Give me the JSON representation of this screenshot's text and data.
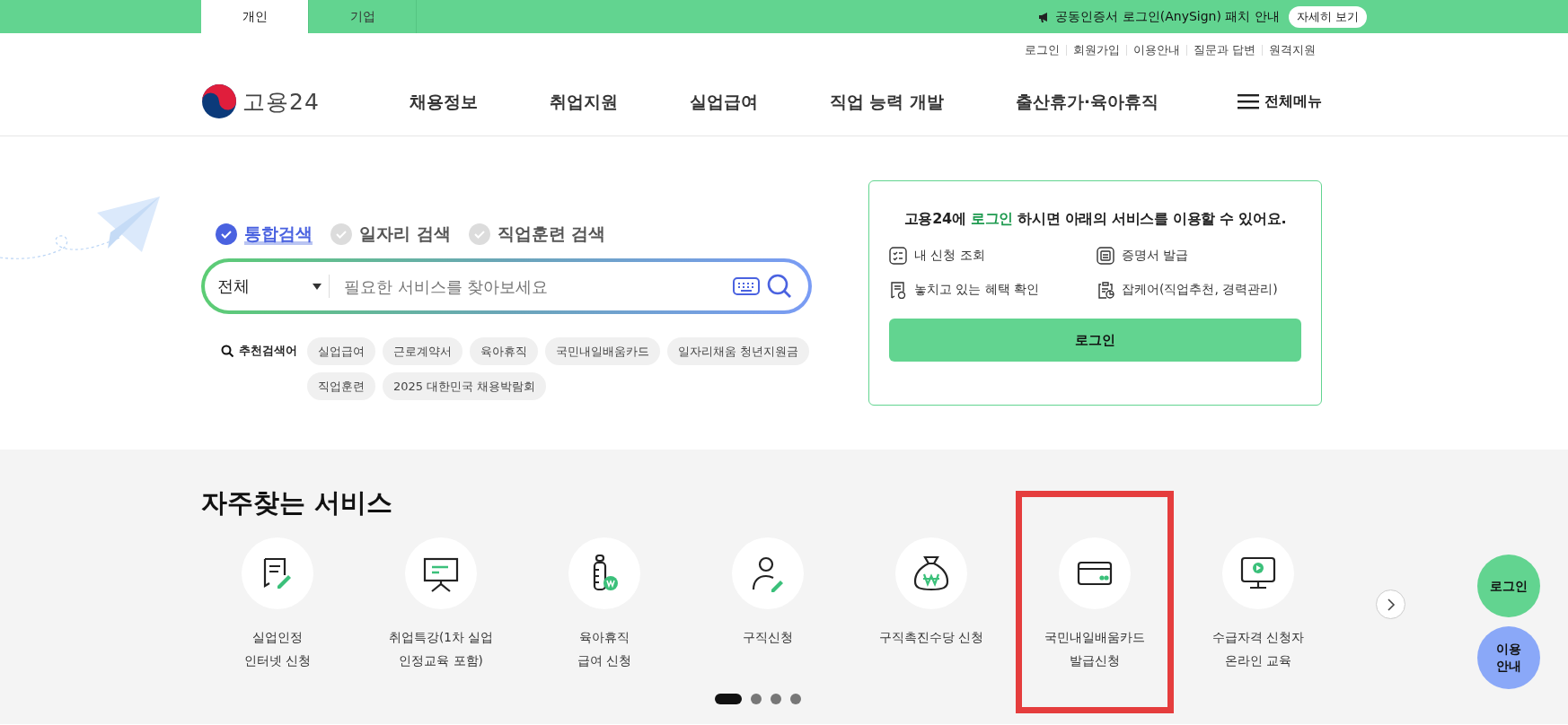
{
  "top_bar": {
    "tabs": [
      {
        "label": "개인",
        "selected": true
      },
      {
        "label": "기업",
        "selected": false
      }
    ],
    "notice": "공동인증서 로그인(AnySign) 패치 안내",
    "notice_button": "자세히 보기"
  },
  "utility_links": [
    "로그인",
    "회원가입",
    "이용안내",
    "질문과 답변",
    "원격지원"
  ],
  "header": {
    "logo_text": "고용24",
    "nav": [
      "채용정보",
      "취업지원",
      "실업급여",
      "직업 능력 개발",
      "출산휴가·육아휴직"
    ],
    "all_menu": "전체메뉴"
  },
  "search": {
    "tabs": [
      {
        "label": "통합검색",
        "selected": true
      },
      {
        "label": "일자리 검색",
        "selected": false
      },
      {
        "label": "직업훈련 검색",
        "selected": false
      }
    ],
    "category": "전체",
    "placeholder": "필요한 서비스를 찾아보세요",
    "recommended_label": "추천검색어",
    "recommended": [
      "실업급여",
      "근로계약서",
      "육아휴직",
      "국민내일배움카드",
      "일자리채움 청년지원금",
      "직업훈련",
      "2025 대한민국 채용박람회"
    ]
  },
  "login_card": {
    "message_before": "고용24에",
    "message_link": "로그인",
    "message_after": "하시면 아래의 서비스를 이용할 수 있어요.",
    "services": [
      "내 신청 조회",
      "증명서 발급",
      "놓치고 있는 혜택 확인",
      "잡케어(직업추천, 경력관리)"
    ],
    "button": "로그인"
  },
  "frequent_services": {
    "title": "자주찾는 서비스",
    "items": [
      {
        "lines": [
          "실업인정",
          "인터넷 신청"
        ],
        "highlighted": false
      },
      {
        "lines": [
          "취업특강(1차 실업",
          "인정교육 포함)"
        ],
        "highlighted": false
      },
      {
        "lines": [
          "육아휴직",
          "급여 신청"
        ],
        "highlighted": false
      },
      {
        "lines": [
          "구직신청"
        ],
        "highlighted": false
      },
      {
        "lines": [
          "구직촉진수당 신청"
        ],
        "highlighted": false
      },
      {
        "lines": [
          "국민내일배움카드",
          "발급신청"
        ],
        "highlighted": true
      },
      {
        "lines": [
          "수급자격 신청자",
          "온라인 교육"
        ],
        "highlighted": false
      }
    ],
    "pager": [
      {
        "selected": true
      },
      {
        "selected": false
      },
      {
        "selected": false
      },
      {
        "selected": false
      }
    ]
  },
  "quick_buttons": [
    {
      "lines": [
        "로그인"
      ],
      "color": "#62d490"
    },
    {
      "lines": [
        "이용",
        "안내"
      ],
      "color": "#8aa8f8"
    }
  ]
}
